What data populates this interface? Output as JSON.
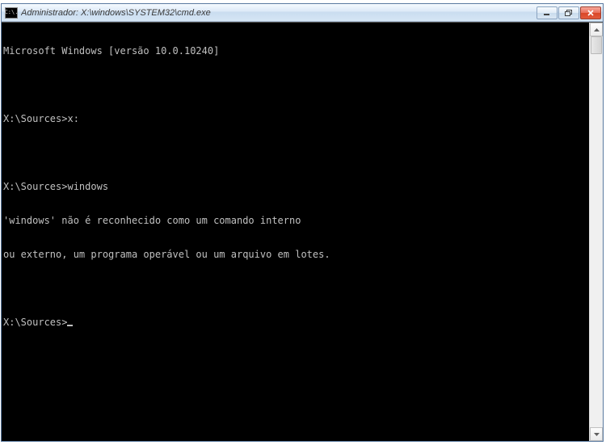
{
  "window": {
    "title": "Administrador: X:\\windows\\SYSTEM32\\cmd.exe",
    "icon_label": "C:\\."
  },
  "console": {
    "lines": [
      "Microsoft Windows [versão 10.0.10240]",
      "",
      "X:\\Sources>x:",
      "",
      "X:\\Sources>windows",
      "'windows' não é reconhecido como um comando interno",
      "ou externo, um programa operável ou um arquivo em lotes.",
      "",
      "X:\\Sources>"
    ]
  }
}
